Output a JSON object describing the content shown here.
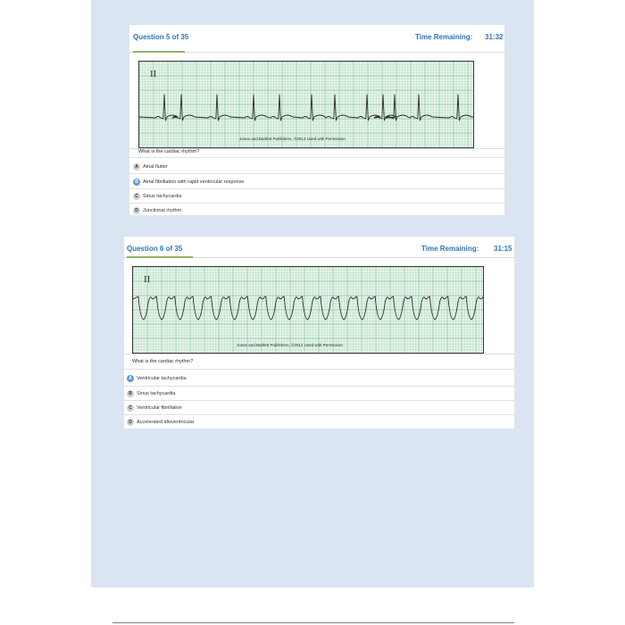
{
  "colors": {
    "page_background": "#dbe5f1",
    "accent_blue": "#2e75b6",
    "progress_green": "#8db36a",
    "ecg_grid_minor": "#a8d5b5",
    "ecg_grid_major": "#7fc39a",
    "ecg_paper": "#e6f4ea"
  },
  "questions": [
    {
      "number_label": "Question 5 of 35",
      "time_label": "Time Remaining:",
      "time_value": "31:32",
      "lead_label": "II",
      "credit": "Jones and Bartlett Publishers, ©2012 Used with Permission",
      "prompt": "What is the cardiac rhythm?",
      "options": [
        {
          "letter": "A",
          "text": "Atrial flutter",
          "highlighted": false
        },
        {
          "letter": "B",
          "text": "Atrial fibrillation with rapid ventricular response",
          "highlighted": true
        },
        {
          "letter": "C",
          "text": "Sinus tachycardia",
          "highlighted": false
        },
        {
          "letter": "D",
          "text": "Junctional rhythm",
          "highlighted": false
        }
      ]
    },
    {
      "number_label": "Question 6 of 35",
      "time_label": "Time Remaining:",
      "time_value": "31:15",
      "lead_label": "II",
      "credit": "Jones and Bartlett Publishers, ©2012 Used with Permission",
      "prompt": "What is the cardiac rhythm?",
      "options": [
        {
          "letter": "A",
          "text": "Ventricular tachycardia",
          "highlighted": true
        },
        {
          "letter": "B",
          "text": "Sinus tachycardia",
          "highlighted": false
        },
        {
          "letter": "C",
          "text": "Ventricular fibrillation",
          "highlighted": false
        },
        {
          "letter": "D",
          "text": "Accelerated idioventricular",
          "highlighted": false
        }
      ]
    }
  ],
  "icons": {
    "ecg_strip_1": "ecg-strip-irregular-narrow-qrs",
    "ecg_strip_2": "ecg-strip-wide-complex-tachycardia"
  }
}
